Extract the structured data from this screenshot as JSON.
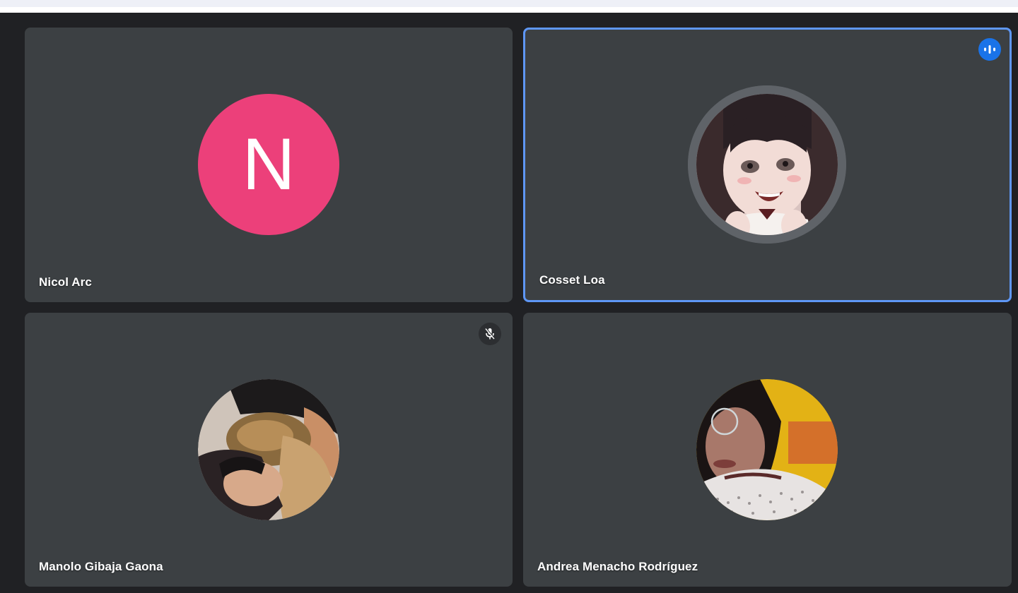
{
  "participants": [
    {
      "name": "Nicol Arc",
      "avatar_type": "letter",
      "initial": "N",
      "avatar_color": "#ec407a",
      "speaking": false,
      "muted": false
    },
    {
      "name": "Cosset Loa",
      "avatar_type": "photo",
      "avatar_icon": "anime-character-avatar",
      "speaking": true,
      "muted": false
    },
    {
      "name": "Manolo Gibaja Gaona",
      "avatar_type": "photo",
      "avatar_icon": "person-with-dog-avatar",
      "speaking": false,
      "muted": true
    },
    {
      "name": "Andrea Menacho Rodríguez",
      "avatar_type": "photo",
      "avatar_icon": "person-selfie-avatar",
      "speaking": false,
      "muted": false
    }
  ],
  "colors": {
    "background": "#202124",
    "tile": "#3c4043",
    "active_border": "#5e97f6",
    "speaking_badge": "#1a73e8",
    "letter_avatar": "#ec407a"
  }
}
